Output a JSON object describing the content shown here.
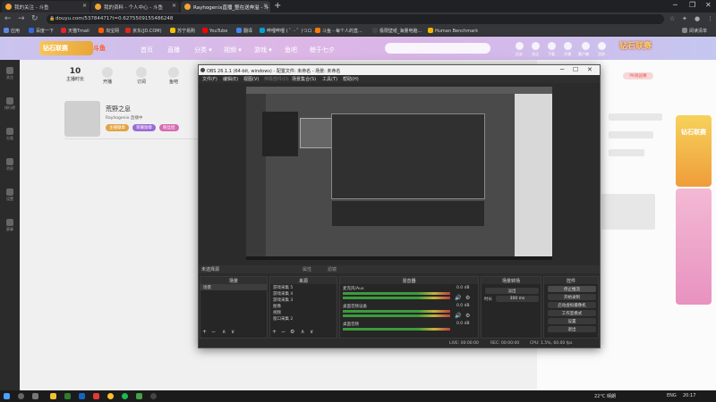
{
  "browser": {
    "tabs": [
      {
        "title": "我的关注 - 斗鱼",
        "active": false
      },
      {
        "title": "我的资料 - 个人中心 - 斗鱼",
        "active": false
      },
      {
        "title": "Rayhogenix直播_整在送奔溢 - 斗",
        "active": true
      }
    ],
    "new_tab": "+",
    "url": "douyu.com/53784471?t=0.6275509155486248",
    "bookmarks": [
      {
        "label": "应用",
        "color": "#5f86e6"
      },
      {
        "label": "百度一下",
        "color": "#3866e3"
      },
      {
        "label": "天猫Tmall",
        "color": "#e0262e"
      },
      {
        "label": "淘宝网",
        "color": "#ff5d00"
      },
      {
        "label": "京东(JD.COM)",
        "color": "#e1251b"
      },
      {
        "label": "苏宁易购",
        "color": "#f6c000"
      },
      {
        "label": "YouTube",
        "color": "#ff0000"
      },
      {
        "label": "翻译",
        "color": "#4285f4"
      },
      {
        "label": "哔哩哔哩 ( ゜- ゜)つロ ...",
        "color": "#00a1d6"
      },
      {
        "label": "斗鱼 - 每个人的直...",
        "color": "#ff7a00"
      },
      {
        "label": "极限壁纸_海量电脑...",
        "color": "#444444"
      },
      {
        "label": "Human Benchmark",
        "color": "#f4b400"
      },
      {
        "label": "阅读清单",
        "color": "#888888"
      }
    ]
  },
  "douyu": {
    "logo": "钻石联赛",
    "logo2": "斗鱼",
    "nav": [
      "首页",
      "直播",
      "分类 ▾",
      "视频 ▾",
      "游戏 ▾",
      "鱼吧",
      "鲸于七夕"
    ],
    "top_icons": [
      "历史",
      "关注",
      "下载",
      "开播",
      "客户端",
      "消息"
    ],
    "brand_right": "钻石联赛",
    "left_items": [
      "关注",
      "排行榜",
      "分类",
      "消息",
      "设置",
      "赛事"
    ],
    "stats": [
      {
        "value": "10",
        "label": "主播时长"
      },
      {
        "value": "",
        "label": "开播"
      },
      {
        "value": "",
        "label": "订阅"
      },
      {
        "value": "",
        "label": "鱼吧"
      }
    ],
    "streamer_name": "荒野之息",
    "streamer_meta": "Rayhogenix 直播中",
    "chips": [
      "主播徽章",
      "荣耀勋章",
      "粉丝团"
    ],
    "pk_pill": "PK挑战赛",
    "promo": "钻石联赛"
  },
  "obs": {
    "title": "OBS 26.1.1 (64-bit, windows) - 配置文件: 未命名 - 场景: 未命名",
    "menu": [
      "文件(F)",
      "编辑(E)",
      "视图(V)",
      "停靠部件(D)",
      "场景集合(S)",
      "工具(T)",
      "帮助(H)"
    ],
    "bar_label": "未选择源",
    "bar_props": [
      "属性",
      "滤镜"
    ],
    "docks": {
      "scenes": {
        "title": "场景",
        "items": [
          "场景"
        ]
      },
      "sources": {
        "title": "来源",
        "items": [
          "游戏采集 5",
          "游戏采集 4",
          "游戏采集 3",
          "图像",
          "视频",
          "窗口采集 2"
        ]
      },
      "mixer": {
        "title": "混音器",
        "channels": [
          {
            "name": "麦克风/Aux",
            "db": "0.0 dB"
          },
          {
            "name": "桌面音频设备",
            "db": "0.0 dB"
          },
          {
            "name": "桌面音频",
            "db": "0.0 dB"
          }
        ]
      },
      "transitions": {
        "title": "场景转场",
        "type": "淡出",
        "duration_label": "时长",
        "duration": "300 ms"
      },
      "controls": {
        "title": "控件",
        "buttons": [
          "停止推流",
          "开始录制",
          "启动虚拟摄像机",
          "工作室模式",
          "设置",
          "退出"
        ]
      }
    },
    "status": [
      "LIVE: 00:00:00",
      "REC: 00:00:00",
      "CPU: 1.5%, 60.00 fps"
    ]
  },
  "taskbar": {
    "weather": "22°C 晴朗",
    "lang": "ENG",
    "time": "20:17"
  }
}
